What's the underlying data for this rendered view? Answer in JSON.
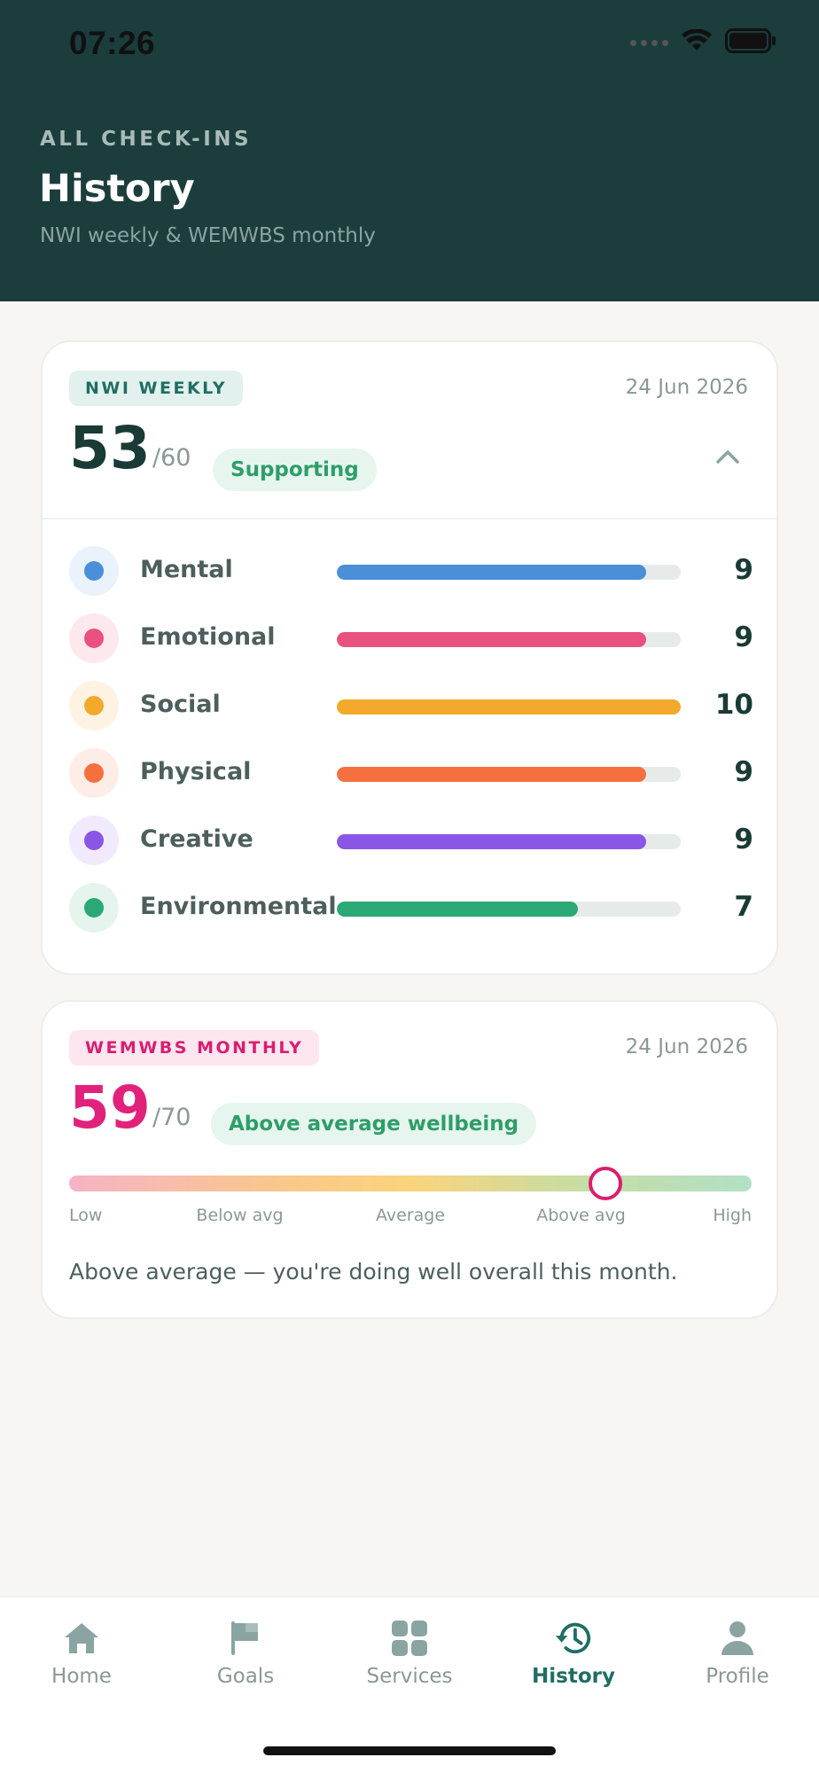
{
  "status_bar": {
    "time": "07:26"
  },
  "header": {
    "eyebrow": "ALL CHECK-INS",
    "title": "History",
    "subtitle": "NWI weekly & WEMWBS monthly"
  },
  "nwi_card": {
    "tag": "NWI WEEKLY",
    "date": "24 Jun 2026",
    "score": "53",
    "max": "/60",
    "status": "Supporting",
    "dimensions": [
      {
        "label": "Mental",
        "value": "9",
        "fraction": 0.9,
        "color": "#4a8fd8",
        "tint": "#eaf2fb"
      },
      {
        "label": "Emotional",
        "value": "9",
        "fraction": 0.9,
        "color": "#e9517e",
        "tint": "#fde8ee"
      },
      {
        "label": "Social",
        "value": "10",
        "fraction": 1.0,
        "color": "#f3a92c",
        "tint": "#fef3e3"
      },
      {
        "label": "Physical",
        "value": "9",
        "fraction": 0.9,
        "color": "#f5703e",
        "tint": "#feece6"
      },
      {
        "label": "Creative",
        "value": "9",
        "fraction": 0.9,
        "color": "#8a56e6",
        "tint": "#f1eafd"
      },
      {
        "label": "Environmental",
        "value": "7",
        "fraction": 0.7,
        "color": "#2aa876",
        "tint": "#e5f5ee"
      }
    ]
  },
  "wem_card": {
    "tag": "WEMWBS MONTHLY",
    "date": "24 Jun 2026",
    "score": "59",
    "max": "/70",
    "status": "Above average wellbeing",
    "gauge_position": 0.786,
    "gauge_labels": [
      "Low",
      "Below avg",
      "Average",
      "Above avg",
      "High"
    ],
    "summary": "Above average — you're doing well overall this month."
  },
  "nav": {
    "items": [
      {
        "label": "Home",
        "icon": "home-icon"
      },
      {
        "label": "Goals",
        "icon": "flag-icon"
      },
      {
        "label": "Services",
        "icon": "grid-icon"
      },
      {
        "label": "History",
        "icon": "history-icon",
        "active": true
      },
      {
        "label": "Profile",
        "icon": "person-icon"
      }
    ]
  },
  "colors": {
    "header_bg": "#1b3d3b",
    "accent": "#1f6e63",
    "wem_accent": "#d81f6f",
    "positive": "#2e9e69"
  }
}
